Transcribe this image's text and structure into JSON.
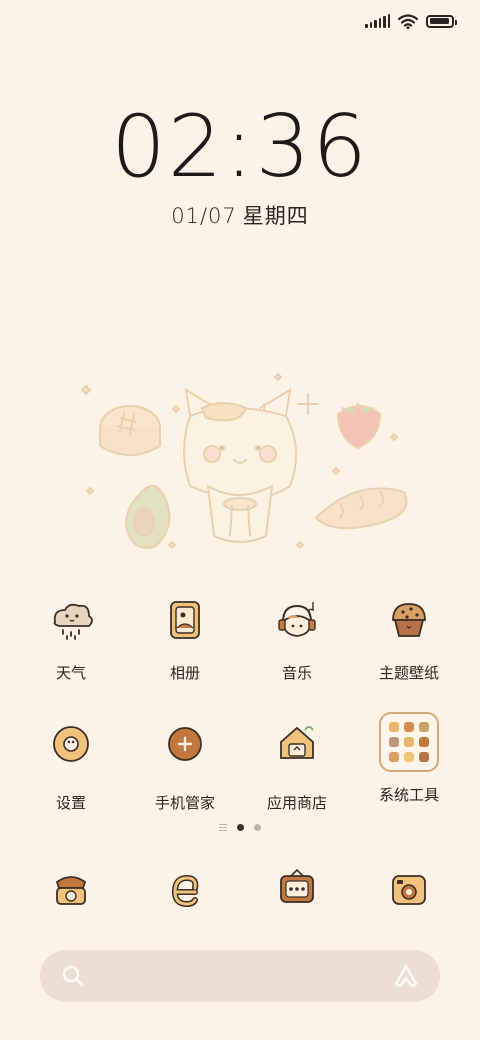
{
  "status_bar": {
    "signal_icon": "signal-icon",
    "wifi_icon": "wifi-icon",
    "battery_icon": "battery-icon",
    "battery_level": 0.9
  },
  "lockscreen": {
    "time": "02:36",
    "date": "01/07",
    "weekday": "星期四"
  },
  "apps": [
    {
      "id": "weather",
      "label": "天气",
      "icon": "weather-cloud-icon"
    },
    {
      "id": "gallery",
      "label": "相册",
      "icon": "photo-frame-icon"
    },
    {
      "id": "music",
      "label": "音乐",
      "icon": "cat-headphones-icon"
    },
    {
      "id": "themes",
      "label": "主题壁纸",
      "icon": "muffin-icon"
    },
    {
      "id": "settings",
      "label": "设置",
      "icon": "donut-gear-icon"
    },
    {
      "id": "security",
      "label": "手机管家",
      "icon": "cookie-plus-icon"
    },
    {
      "id": "store",
      "label": "应用商店",
      "icon": "shop-house-icon"
    },
    {
      "id": "tools",
      "label": "系统工具",
      "icon": "folder-icon"
    }
  ],
  "dock": [
    {
      "id": "phone",
      "icon": "telephone-icon"
    },
    {
      "id": "browser",
      "icon": "e-browser-icon"
    },
    {
      "id": "messages",
      "icon": "message-board-icon"
    },
    {
      "id": "camera",
      "icon": "camera-icon"
    }
  ],
  "page_indicator": {
    "pages": 2,
    "active": 1
  },
  "search": {
    "search_icon": "search-icon",
    "assistant_icon": "assistant-a-icon"
  },
  "colors": {
    "background": "#fcf3e6",
    "accent": "#e8b56a",
    "search_bg": "#eadfd2",
    "text": "#2a2520"
  }
}
